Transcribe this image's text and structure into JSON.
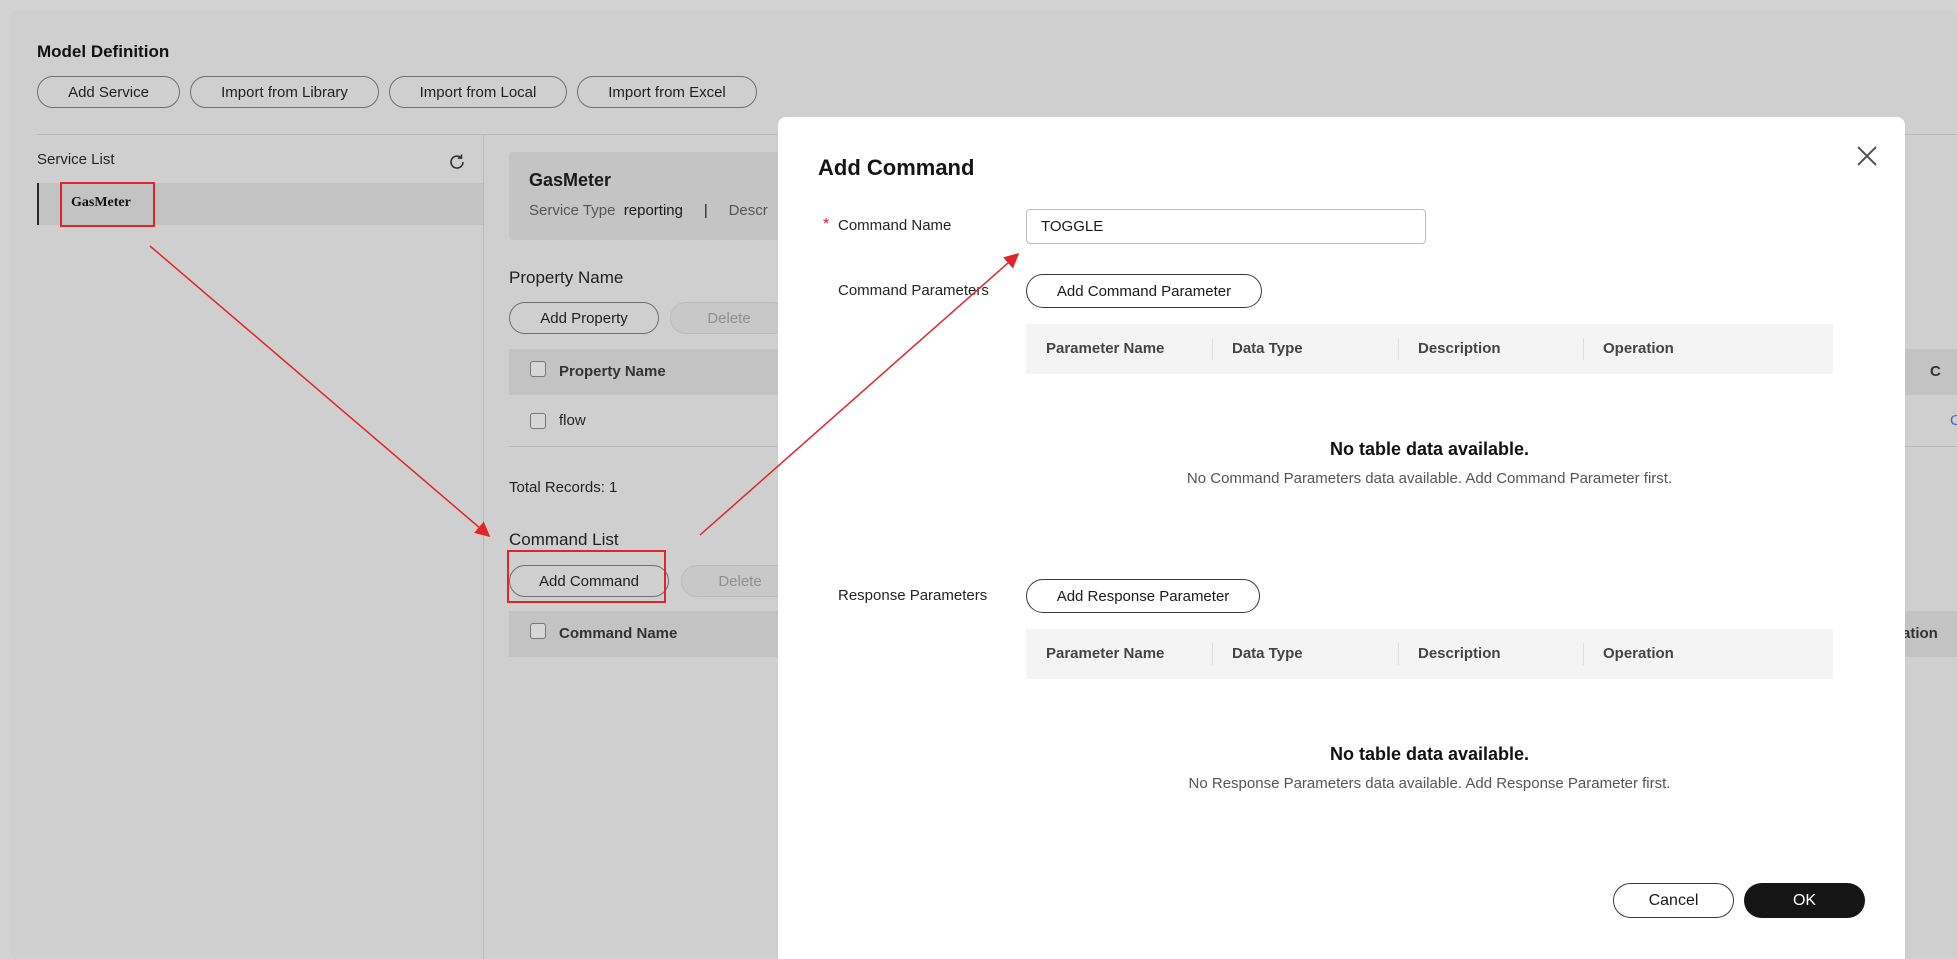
{
  "page": {
    "title": "Model Definition",
    "toolbar": [
      "Add Service",
      "Import from Library",
      "Import from Local",
      "Import from Excel"
    ]
  },
  "service_list": {
    "label": "Service List",
    "items": [
      "GasMeter"
    ]
  },
  "service_detail": {
    "name": "GasMeter",
    "type_label": "Service Type",
    "type_value": "reporting",
    "separator": "|",
    "desc_label_partial": "Descr"
  },
  "properties": {
    "title": "Property Name",
    "add_label": "Add Property",
    "delete_label": "Delete",
    "header": "Property Name",
    "rows": [
      "flow"
    ],
    "total": "Total Records: 1",
    "partial_col": "C",
    "partial_link": "C"
  },
  "commands": {
    "title": "Command List",
    "add_label": "Add Command",
    "delete_label": "Delete",
    "header": "Command Name",
    "partial_col": "ation"
  },
  "modal": {
    "title": "Add Command",
    "required_mark": "*",
    "command_name_label": "Command Name",
    "command_name_value": "TOGGLE",
    "command_params_label": "Command Parameters",
    "add_command_param": "Add Command Parameter",
    "response_params_label": "Response Parameters",
    "add_response_param": "Add Response Parameter",
    "columns": [
      "Parameter Name",
      "Data Type",
      "Description",
      "Operation"
    ],
    "empty_title": "No table data available.",
    "command_empty_sub": "No Command Parameters data available. Add Command Parameter first.",
    "response_empty_sub": "No Response Parameters data available. Add Response Parameter first.",
    "cancel_label": "Cancel",
    "ok_label": "OK"
  },
  "colors": {
    "annotation": "#e0252a",
    "primary_button": "#151515",
    "backdrop": "#cfcfcf"
  }
}
